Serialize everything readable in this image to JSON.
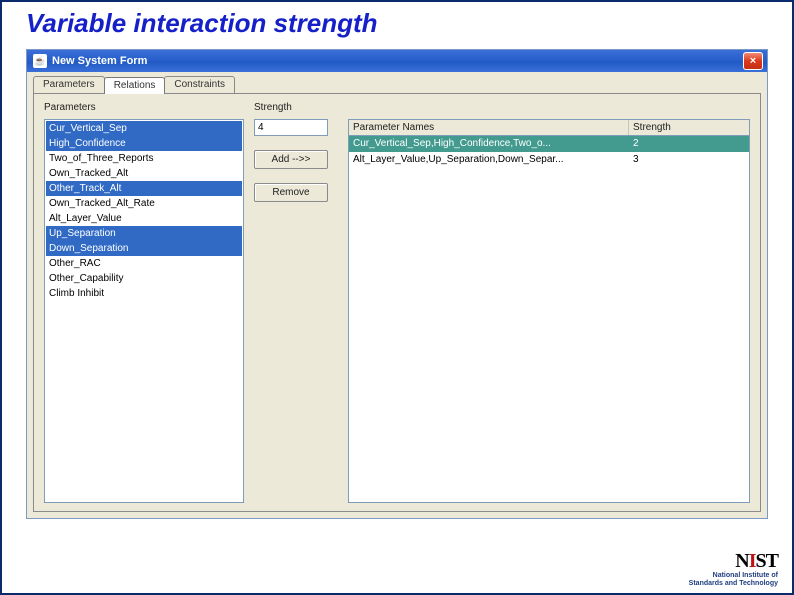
{
  "slide": {
    "title": "Variable interaction strength"
  },
  "window": {
    "title": "New System Form",
    "close_glyph": "×",
    "java_glyph": "☕"
  },
  "tabs": [
    {
      "label": "Parameters"
    },
    {
      "label": "Relations"
    },
    {
      "label": "Constraints"
    }
  ],
  "left": {
    "label": "Parameters",
    "items": [
      {
        "label": "Cur_Vertical_Sep",
        "sel": true
      },
      {
        "label": "High_Confidence",
        "sel": true
      },
      {
        "label": "Two_of_Three_Reports",
        "sel": false
      },
      {
        "label": "Own_Tracked_Alt",
        "sel": false
      },
      {
        "label": "Other_Track_Alt",
        "sel": true
      },
      {
        "label": "Own_Tracked_Alt_Rate",
        "sel": false
      },
      {
        "label": "Alt_Layer_Value",
        "sel": false
      },
      {
        "label": "Up_Separation",
        "sel": true
      },
      {
        "label": "Down_Separation",
        "sel": true
      },
      {
        "label": "Other_RAC",
        "sel": false
      },
      {
        "label": "Other_Capability",
        "sel": false
      },
      {
        "label": "Climb Inhibit",
        "sel": false
      }
    ]
  },
  "mid": {
    "strength_label": "Strength",
    "strength_value": "4",
    "add_label": "Add -->>",
    "remove_label": "Remove"
  },
  "right": {
    "header_param": "Parameter Names",
    "header_strength": "Strength",
    "rows": [
      {
        "params": "Cur_Vertical_Sep,High_Confidence,Two_o...",
        "strength": "2",
        "sel": true
      },
      {
        "params": "Alt_Layer_Value,Up_Separation,Down_Separ...",
        "strength": "3",
        "sel": false
      }
    ]
  },
  "logo": {
    "nist": "NIST",
    "line1": "National Institute of",
    "line2": "Standards and Technology"
  }
}
